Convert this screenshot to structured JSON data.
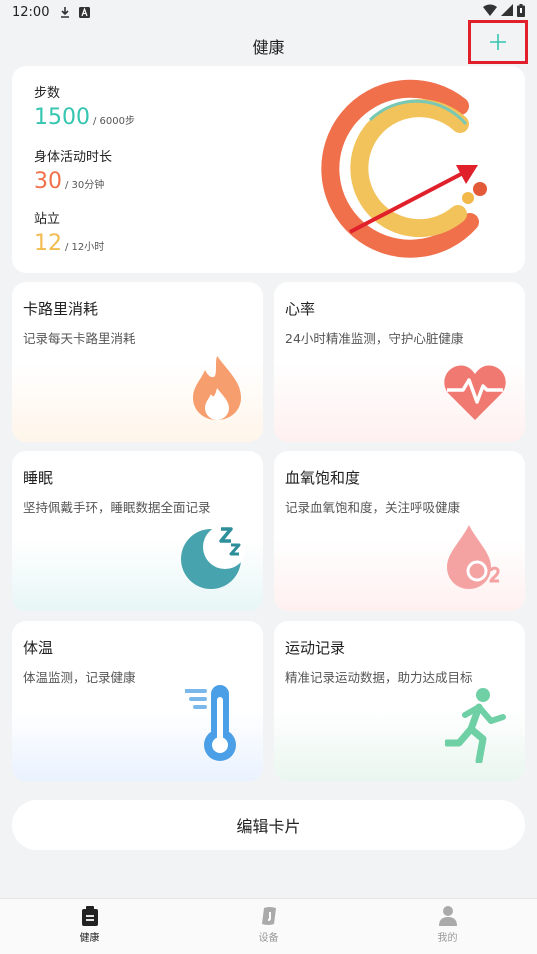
{
  "status_bar": {
    "time": "12:00"
  },
  "header": {
    "title": "健康"
  },
  "summary": {
    "steps": {
      "label": "步数",
      "value": "1500",
      "target": "/ 6000步",
      "color": "#35c5b0"
    },
    "activity": {
      "label": "身体活动时长",
      "value": "30",
      "target": "/ 30分钟",
      "color": "#f0704b"
    },
    "stand": {
      "label": "站立",
      "value": "12",
      "target": "/ 12小时",
      "color": "#f2bc4f"
    }
  },
  "tiles": {
    "calories": {
      "title": "卡路里消耗",
      "desc": "记录每天卡路里消耗"
    },
    "heart": {
      "title": "心率",
      "desc": "24小时精准监测，守护心脏健康"
    },
    "sleep": {
      "title": "睡眠",
      "desc": "坚持佩戴手环，睡眠数据全面记录"
    },
    "spo2": {
      "title": "血氧饱和度",
      "desc": "记录血氧饱和度，关注呼吸健康"
    },
    "temp": {
      "title": "体温",
      "desc": "体温监测，记录健康"
    },
    "exercise": {
      "title": "运动记录",
      "desc": "精准记录运动数据，助力达成目标"
    }
  },
  "edit_button": "编辑卡片",
  "nav": {
    "health": "健康",
    "device": "设备",
    "me": "我的"
  },
  "colors": {
    "accent": "#35c5b0",
    "highlight": "#e0202a"
  }
}
